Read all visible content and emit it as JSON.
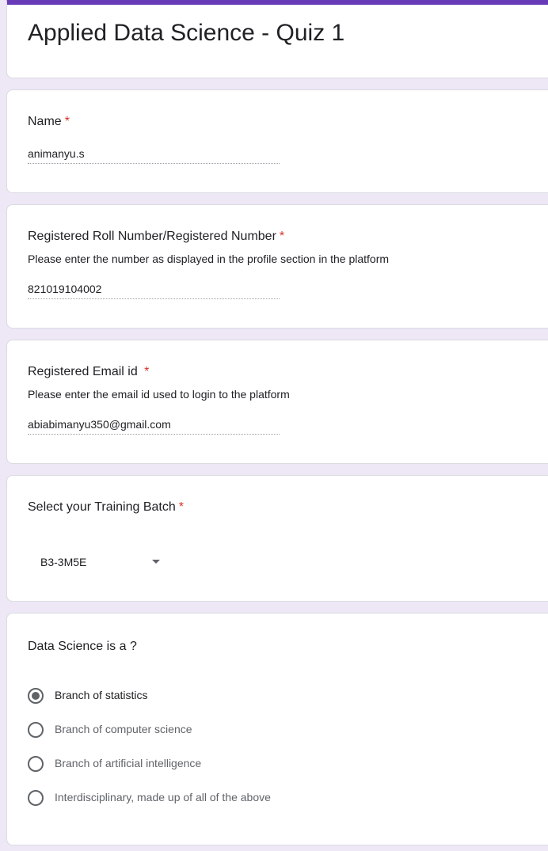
{
  "form": {
    "title": "Applied Data Science - Quiz 1",
    "required_marker": "*"
  },
  "questions": {
    "name": {
      "label": "Name",
      "value": "animanyu.s"
    },
    "roll": {
      "label": "Registered Roll Number/Registered Number",
      "description": "Please enter the number as displayed in the profile section in the platform",
      "value": "821019104002"
    },
    "email": {
      "label": "Registered Email id ",
      "description": "Please enter the email id used to login to the platform",
      "value": "abiabimanyu350@gmail.com"
    },
    "batch": {
      "label": "Select your Training Batch",
      "selected": "B3-3M5E"
    },
    "mcq": {
      "label": "Data Science is a ?",
      "options": [
        {
          "label": "Branch of statistics",
          "checked": true
        },
        {
          "label": "Branch of computer science",
          "checked": false
        },
        {
          "label": "Branch of artificial intelligence",
          "checked": false
        },
        {
          "label": "Interdisciplinary, made up of all of the above",
          "checked": false
        }
      ]
    }
  },
  "colors": {
    "accent": "#673ab7",
    "background": "#ede7f6",
    "required": "#d93025"
  }
}
